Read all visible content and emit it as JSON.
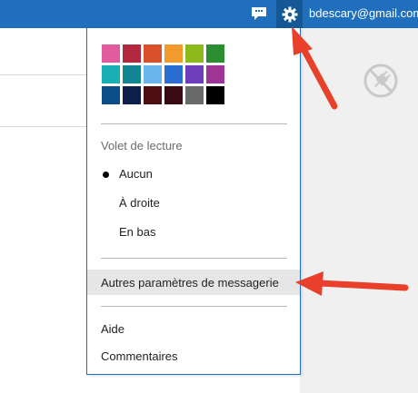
{
  "header": {
    "user_email": "bdescary@gmail.com",
    "chat_icon": "chat-bubble-icon",
    "settings_icon": "gear-icon"
  },
  "menu": {
    "colors": [
      "#e05c9d",
      "#b2283f",
      "#d9512b",
      "#f29a2c",
      "#8dba1a",
      "#2b8f31",
      "#18b0b5",
      "#128593",
      "#6bb5ef",
      "#2b6ed2",
      "#6d3dbc",
      "#9c3596",
      "#0c4e8a",
      "#0e1e4b",
      "#4e0e13",
      "#3a0a13",
      "#6a6a6a",
      "#000000"
    ],
    "reading_pane": {
      "label": "Volet de lecture",
      "selected": "Aucun",
      "options": [
        "Aucun",
        "À droite",
        "En bas"
      ]
    },
    "more_settings": "Autres paramètres de messagerie",
    "help": "Aide",
    "feedback": "Commentaires"
  },
  "sidebar": {
    "plugin_icon": "no-plugin-icon"
  },
  "annotations": {
    "arrow_color": "#e8402a"
  }
}
